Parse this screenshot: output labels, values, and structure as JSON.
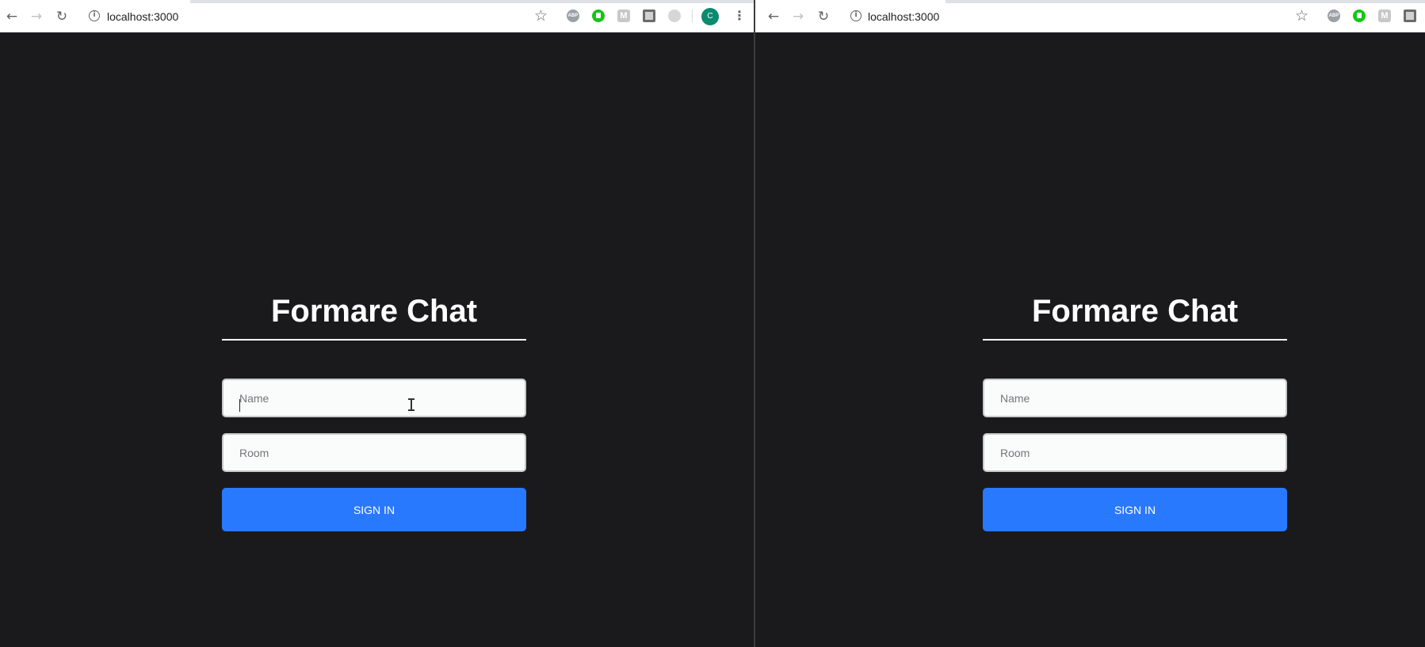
{
  "browser_left": {
    "url": "localhost:3000",
    "profile_initial": "C",
    "extensions": [
      "abp-icon",
      "thumbs-up-icon",
      "m-icon",
      "dark-extension-icon",
      "grey-extension-icon"
    ]
  },
  "browser_right": {
    "url": "localhost:3000",
    "extensions": [
      "abp-icon",
      "thumbs-up-icon",
      "m-icon",
      "dark-extension-icon"
    ]
  },
  "join_left": {
    "title": "Formare Chat",
    "name_placeholder": "Name",
    "room_placeholder": "Room",
    "button_label": "SIGN IN"
  },
  "join_right": {
    "title": "Formare Chat",
    "name_placeholder": "Name",
    "room_placeholder": "Room",
    "button_label": "SIGN IN"
  },
  "colors": {
    "page_background": "#1a1a1d",
    "button": "#2979ff",
    "input_background": "#fafbfb",
    "text": "#ffffff"
  }
}
